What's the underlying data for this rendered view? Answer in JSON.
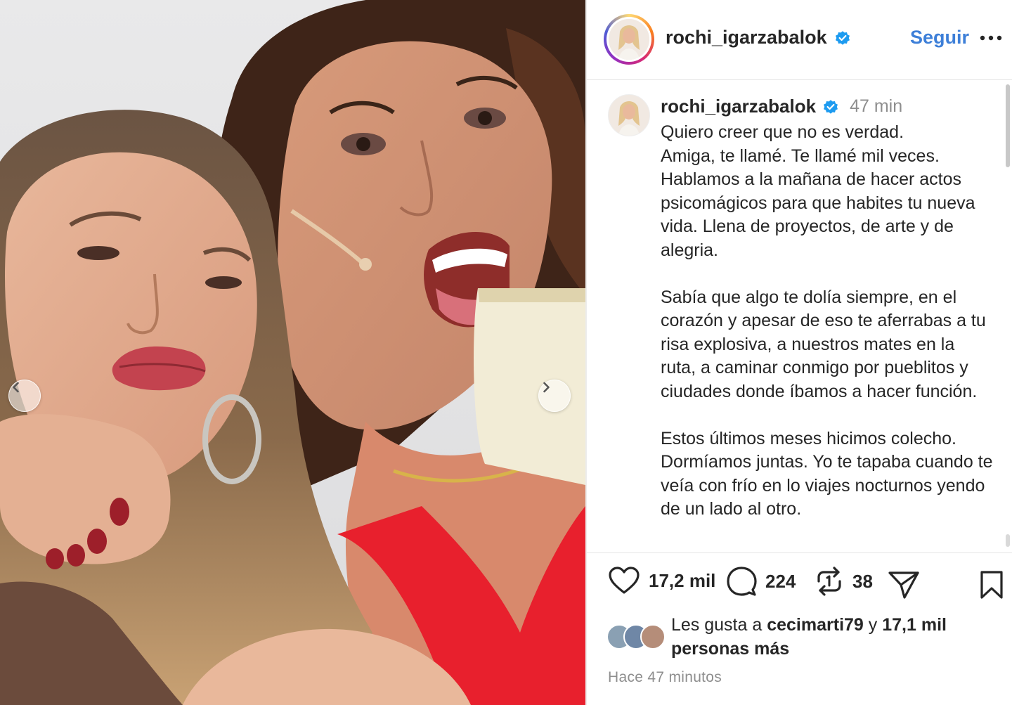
{
  "post": {
    "username": "rochi_igarzabalok",
    "follow_label": "Seguir",
    "time_ago": "47 min",
    "caption": "Quiero creer que no es verdad.\nAmiga, te llamé. Te llamé mil veces.\nHablamos a la mañana de hacer actos psicomágicos para que habites tu nueva vida. Llena de proyectos, de arte y de alegria.\n\nSabía que algo te dolía siempre, en el corazón y apesar de eso te aferrabas a tu risa explosiva, a nuestros mates en la ruta, a caminar conmigo por pueblitos y ciudades donde íbamos a hacer función.\n\nEstos últimos meses hicimos colecho. Dormíamos juntas. Yo te tapaba cuando te veía con frío en lo viajes nocturnos yendo de un lado al otro.",
    "stats": {
      "likes": "17,2 mil",
      "comments": "224",
      "reposts": "38"
    },
    "likes_summary": {
      "prefix": "Les gusta a ",
      "user": "cecimarti79",
      "middle": " y ",
      "count": "17,1 mil",
      "suffix": "personas más"
    },
    "posted_ago": "Hace 47 minutos"
  },
  "colors": {
    "link_blue": "#3d7fd8",
    "verified_blue": "#1d9bf0",
    "text": "#262626",
    "muted": "#8e8e8e"
  },
  "icons": [
    "heart-icon",
    "comment-icon",
    "repost-icon",
    "share-icon",
    "bookmark-icon",
    "more-icon",
    "verified-icon",
    "chevron-left-icon",
    "chevron-right-icon"
  ]
}
